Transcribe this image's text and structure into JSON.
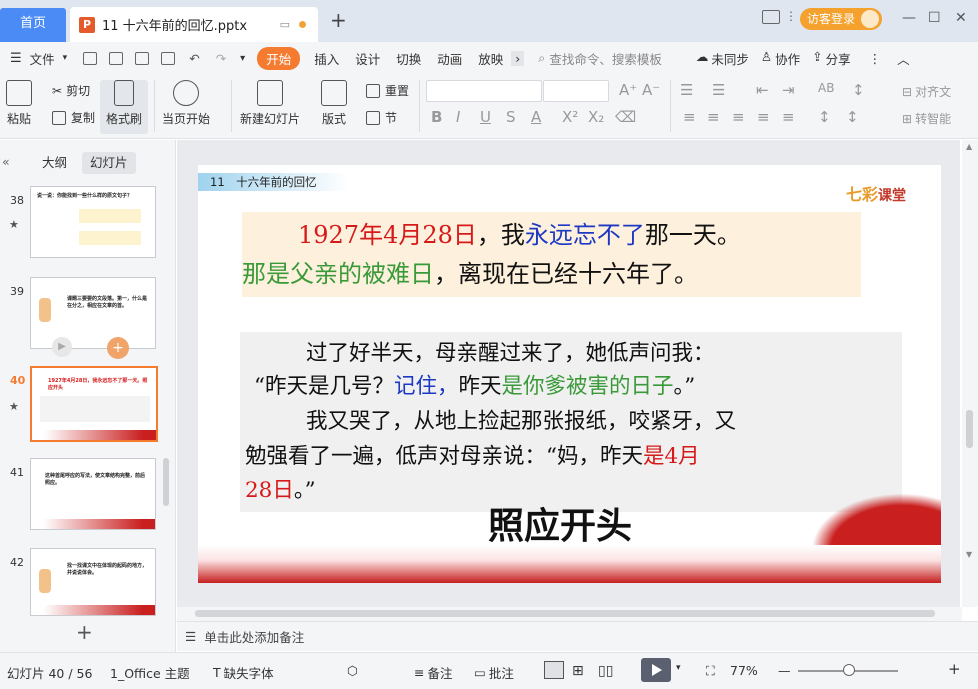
{
  "titlebar": {
    "home_tab": "首页",
    "doc_tab": "11 十六年前的回忆.pptx",
    "new_tab": "+",
    "login_label": "访客登录",
    "minimize": "—",
    "maximize": "☐",
    "close": "✕"
  },
  "menubar": {
    "file": "文件",
    "start": "开始",
    "items": [
      "插入",
      "设计",
      "切换",
      "动画",
      "放映"
    ],
    "more": "›",
    "search": "查找命令、搜索模板",
    "sync": "未同步",
    "collab": "协作",
    "share": "分享"
  },
  "ribbon": {
    "paste": "粘贴",
    "cut": "剪切",
    "copy": "复制",
    "painter": "格式刷",
    "from_current": "当页开始",
    "new_slide": "新建幻灯片",
    "layout": "版式",
    "reset": "重置",
    "section": "节",
    "align_text": "对齐文",
    "convert": "转智能"
  },
  "leftpane": {
    "tab_outline": "大纲",
    "tab_slides": "幻灯片",
    "thumbs": [
      {
        "num": "38",
        "text": "说一说：你能找到一些什么样的原文句子？"
      },
      {
        "num": "39",
        "text": "课题三要要的文段落。第一，什么是在分之，相应在文章的首。"
      },
      {
        "num": "40",
        "text": "1927年4月28日，我永远忘不了那一天。照应开头"
      },
      {
        "num": "41",
        "text": "这种首尾呼应的写法，使文章结构完整，前后照应。"
      },
      {
        "num": "42",
        "text": "找一找课文中在体现的起码的地方，并说说体会。"
      }
    ]
  },
  "slide": {
    "header": "11　十六年前的回忆",
    "logo_a": "七彩",
    "logo_b": "课堂",
    "l1_red": "1927年4月28日",
    "l1_a": "，我",
    "l1_blue": "永远忘不了",
    "l1_b": "那一天。",
    "l2_green": "那是父亲的被难日",
    "l2_a": "，离现在已经十六年了。",
    "p1": "过了好半天，母亲醒过来了，她低声问我：",
    "p2_a": "“昨天是几号？",
    "p2_blue": "记住，",
    "p2_b": "昨天",
    "p2_green": "是你爹被害的日子",
    "p2_c": "。”",
    "p3": "我又哭了，从地上捡起那张报纸，咬紧牙，又",
    "p4_a": "勉强看了一遍，低声对母亲说：“妈，昨天",
    "p4_red": "是4月",
    "p5_red": "28日",
    "p5_a": "。”",
    "big_title": "照应开头"
  },
  "notes": {
    "placeholder": "单击此处添加备注"
  },
  "statusbar": {
    "slide_count": "幻灯片 40 / 56",
    "theme": "1_Office 主题",
    "missing_font": "缺失字体",
    "notes": "备注",
    "comments": "批注",
    "zoom": "77%",
    "zoom_minus": "—",
    "zoom_plus": "+"
  },
  "colors": {
    "accent_orange": "#f57b30",
    "home_blue": "#4a8bf5",
    "text_red": "#d61a1a",
    "text_blue": "#1d39c4",
    "text_green": "#3a9a3a"
  }
}
